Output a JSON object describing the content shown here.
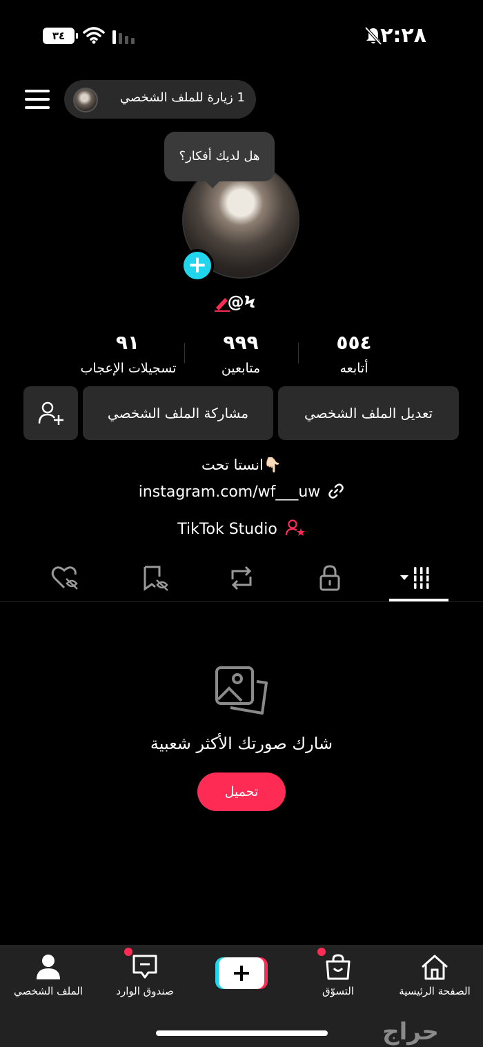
{
  "status_bar": {
    "time": "٢:٢٨",
    "battery": "٣٤"
  },
  "top": {
    "visits": "1 زيارة للملف الشخصي"
  },
  "tooltip": "هل لديك أفكار؟",
  "profile": {
    "username": "@Ϟ"
  },
  "stats": [
    {
      "value": "٥٥٤",
      "label": "أتابعه"
    },
    {
      "value": "٩٩٩",
      "label": "متابعين"
    },
    {
      "value": "٩١",
      "label": "تسجيلات الإعجاب"
    }
  ],
  "buttons": {
    "edit": "تعديل الملف الشخصي",
    "share": "مشاركة الملف الشخصي"
  },
  "bio": {
    "line1": "انستا تحت👇🏻",
    "link": "instagram.com/wf___uw",
    "studio": "TikTok Studio"
  },
  "empty_state": {
    "title": "شارك صورتك الأكثر شعبية",
    "button": "تحميل"
  },
  "nav": {
    "home": "الصفحة الرئيسية",
    "shop": "التسوّق",
    "inbox": "صندوق الوارد",
    "profile": "الملف الشخصي"
  },
  "watermark": "حراج"
}
